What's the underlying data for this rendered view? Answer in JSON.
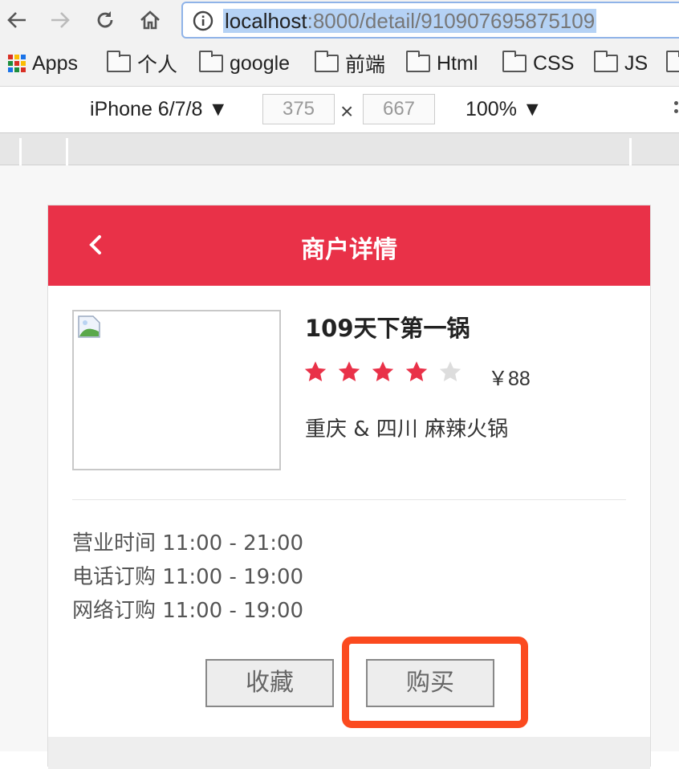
{
  "browser": {
    "url_host": "localhost",
    "url_rest": ":8000/detail/910907695875109"
  },
  "bookmarks": [
    {
      "label": "Apps",
      "icon": "apps-grid-icon"
    },
    {
      "label": "个人",
      "icon": "folder-icon"
    },
    {
      "label": "google",
      "icon": "folder-icon"
    },
    {
      "label": "前端",
      "icon": "folder-icon"
    },
    {
      "label": "Html",
      "icon": "folder-icon"
    },
    {
      "label": "CSS",
      "icon": "folder-icon"
    },
    {
      "label": "JS",
      "icon": "folder-icon"
    }
  ],
  "devtools": {
    "device": "iPhone 6/7/8 ▼",
    "width": "375",
    "height": "667",
    "times": "×",
    "zoom": "100% ▼"
  },
  "page": {
    "title": "商户详情",
    "shop_name": "109天下第一锅",
    "rating": 4,
    "rating_max": 5,
    "price": "￥88",
    "cuisine": "重庆 & 四川 麻辣火锅",
    "hours": [
      "营业时间 11:00 - 21:00",
      "电话订购 11:00 - 19:00",
      "网络订购 11:00 - 19:00"
    ],
    "collect_label": "收藏",
    "buy_label": "购买"
  },
  "colors": {
    "brand_red": "#e93148",
    "star_on": "#e93148",
    "star_off": "#dddddd",
    "annotation": "#fb4a1f"
  }
}
